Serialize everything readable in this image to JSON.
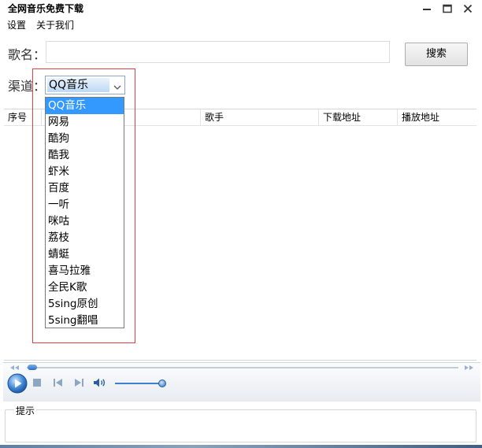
{
  "window": {
    "title": "全网音乐免费下载",
    "controls": [
      "minimize-icon",
      "maximize-icon",
      "close-icon"
    ]
  },
  "menu": {
    "items": [
      "设置",
      "关于我们"
    ]
  },
  "search": {
    "song_label": "歌名：",
    "song_value": "",
    "search_button": "搜索"
  },
  "channel": {
    "label": "渠道：",
    "selected": "QQ音乐",
    "options": [
      "QQ音乐",
      "网易",
      "酷狗",
      "酷我",
      "虾米",
      "百度",
      "一听",
      "咪咕",
      "荔枝",
      "蜻蜓",
      "喜马拉雅",
      "全民K歌",
      "5sing原创",
      "5sing翻唱"
    ]
  },
  "table": {
    "columns": [
      "序号",
      "",
      "歌手",
      "下载地址",
      "播放地址"
    ]
  },
  "player": {
    "icons": [
      "play-icon",
      "stop-icon",
      "previous-icon",
      "next-icon",
      "volume-icon"
    ],
    "accent": "#2b6fc2"
  },
  "tips": {
    "label": "提示"
  },
  "colors": {
    "selection": "#3399ff",
    "annotation": "#e04040"
  }
}
